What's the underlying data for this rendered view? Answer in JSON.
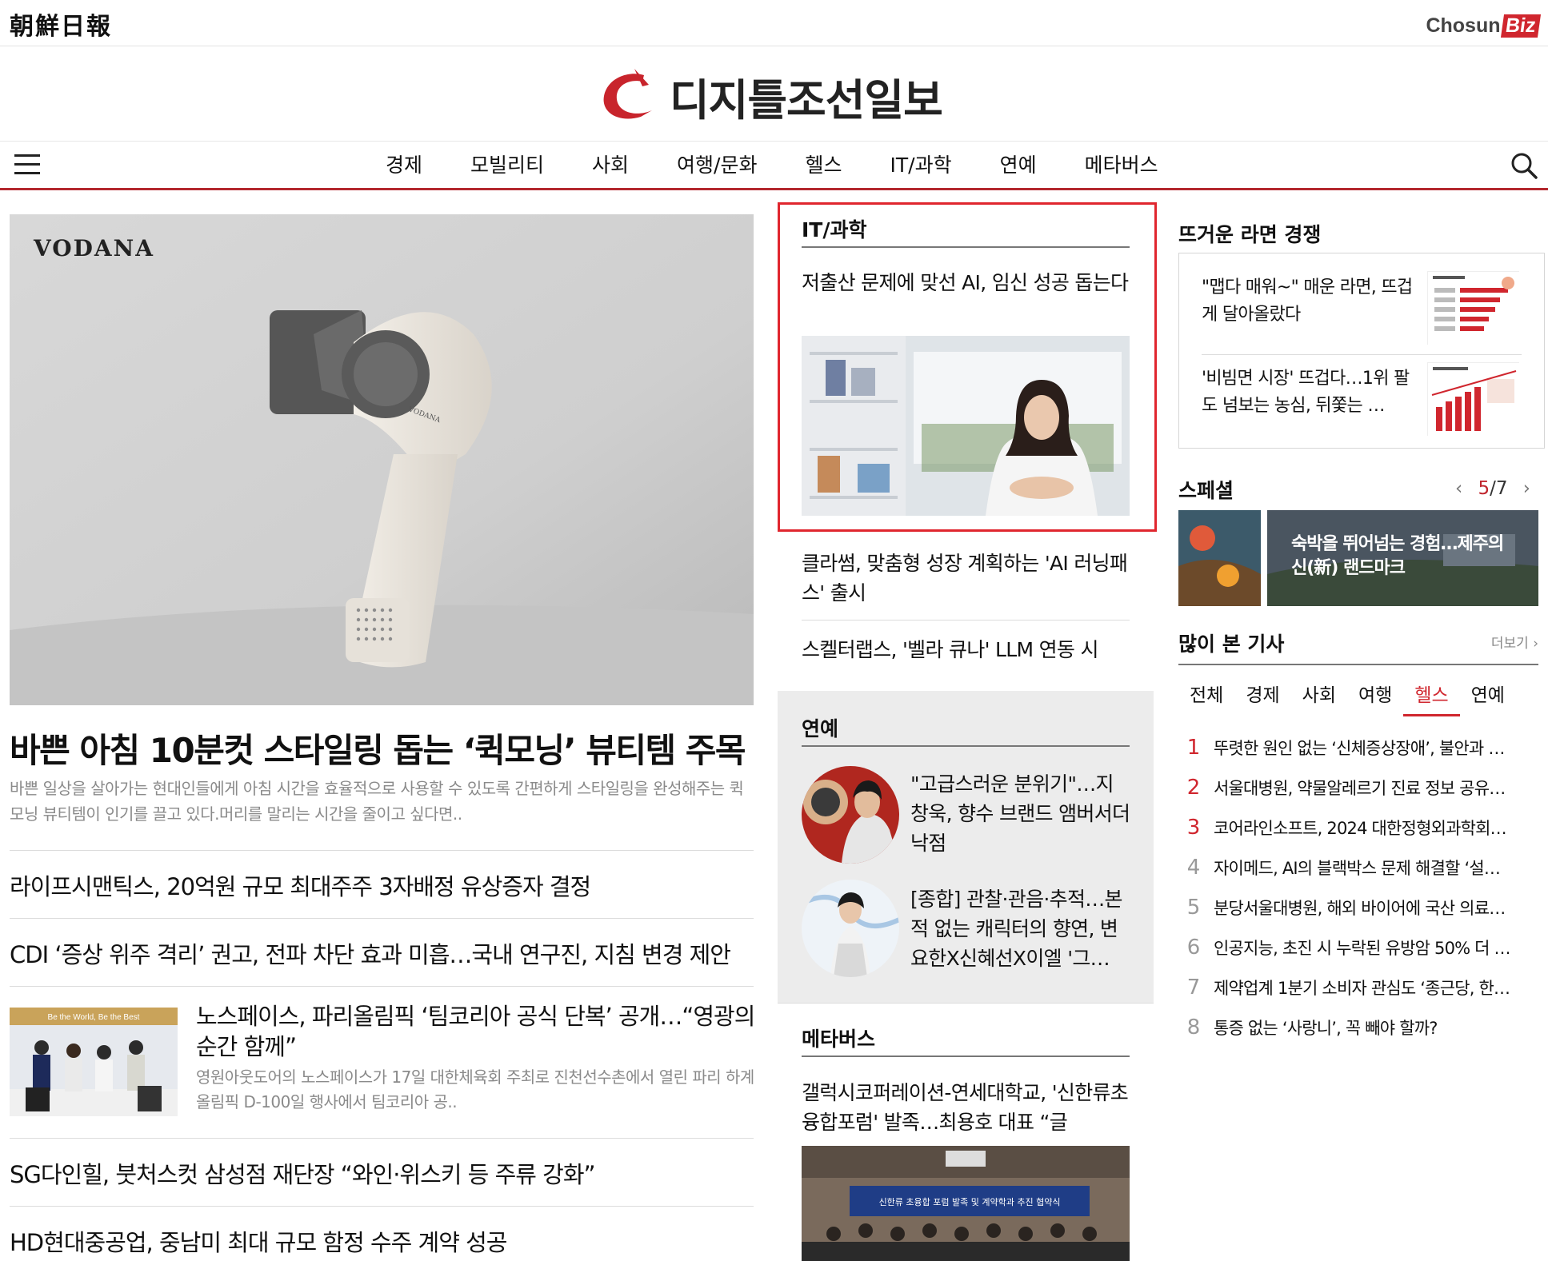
{
  "header": {
    "left_brand": "朝鮮日報",
    "right_brand_a": "Chosun",
    "right_brand_b": "Biz",
    "site_name": "디지틀조선일보"
  },
  "nav": {
    "items": [
      "경제",
      "모빌리티",
      "사회",
      "여행/문화",
      "헬스",
      "IT/과학",
      "연예",
      "메타버스"
    ]
  },
  "hero": {
    "image_brand": "VODANA",
    "product_brand": "VODANA",
    "title": "바쁜 아침 10분컷 스타일링 돕는 ‘퀵모닝’ 뷰티템 주목",
    "desc": "바쁜 일상을 살아가는 현대인들에게 아침 시간을 효율적으로 사용할 수 있도록 간편하게 스타일링을 완성해주는 퀵모닝 뷰티템이 인기를 끌고 있다.머리를 말리는 시간을 줄이고 싶다면.."
  },
  "left_list": [
    "라이프시맨틱스, 20억원 규모 최대주주 3자배정 유상증자 결정",
    "CDI ‘증상 위주 격리’ 권고, 전파 차단 효과 미흡…국내 연구진, 지침 변경 제안"
  ],
  "left_feature": {
    "thumb_banner": "Be the World, Be the Best",
    "title": "노스페이스, 파리올림픽 ‘팀코리아 공식 단복’ 공개…“영광의 순간 함께”",
    "desc": "영원아웃도어의 노스페이스가 17일 대한체육회 주최로 진천선수촌에서 열린 파리 하계올림픽 D-100일 행사에서 팀코리아 공.."
  },
  "left_list2": [
    "SG다인힐, 붓처스컷 삼성점 재단장 “와인·위스키 등 주류 강화”",
    "HD현대중공업, 중남미 최대 규모 함정 수주 계약 성공"
  ],
  "it_section": {
    "title": "IT/과학",
    "lead_title": "저출산 문제에 맞선 AI, 임신 성공 돕는다",
    "items": [
      "클라썸, 맞춤형 성장 계획하는 'AI 러닝패스' 출시",
      "스켈터랩스, '벨라 큐나' LLM 연동 시"
    ]
  },
  "ent_section": {
    "title": "연예",
    "items": [
      "\"고급스러운 분위기\"…지창욱, 향수 브랜드 앰버서더 낙점",
      "[종합] 관찰·관음·추적…본 적 없는 캐릭터의 향연, 변요한X신혜선X이엘 '그…"
    ]
  },
  "meta_section": {
    "title": "메타버스",
    "lead_title": "갤럭시코퍼레이션-연세대학교, '신한류초융합포럼' 발족…최용호 대표 “글",
    "banner": "신한류 초융합 포럼 발족 및 계약학과 추진 협약식"
  },
  "ramen": {
    "title": "뜨거운 라면 경쟁",
    "items": [
      "\"맵다 매워~\" 매운 라면, 뜨겁게 달아올랐다",
      "'비빔면 시장' 뜨겁다…1위 팔도 넘보는 농심, 뒤쫓는 …"
    ]
  },
  "special": {
    "title": "스페셜",
    "page_current": "5",
    "page_sep": "/",
    "page_total": "7",
    "banner_text": "숙박을 뛰어넘는 경험…제주의 신(新) 랜드마크"
  },
  "most_viewed": {
    "title": "많이 본 기사",
    "more": "더보기",
    "tabs": [
      "전체",
      "경제",
      "사회",
      "여행",
      "헬스",
      "연예"
    ],
    "active_tab": "헬스",
    "items": [
      "뚜렷한 원인 없는 ‘신체증상장애’, 불안과 …",
      "서울대병원, 약물알레르기 진료 정보 공유…",
      "코어라인소프트, 2024 대한정형외과학회…",
      "자이메드, AI의 블랙박스 문제 해결할 ‘설…",
      "분당서울대병원, 해외 바이어에 국산 의료…",
      "인공지능, 초진 시 누락된 유방암 50% 더 …",
      "제약업계 1분기 소비자 관심도 ‘종근당, 한…",
      "통증 없는 ‘사랑니’, 꼭 빼야 할까?"
    ],
    "ranks": [
      "1",
      "2",
      "3",
      "4",
      "5",
      "6",
      "7",
      "8"
    ]
  },
  "colors": {
    "accent_red": "#d0262e",
    "nav_rule": "#b3272d",
    "gray_text": "#8a8a8a"
  }
}
